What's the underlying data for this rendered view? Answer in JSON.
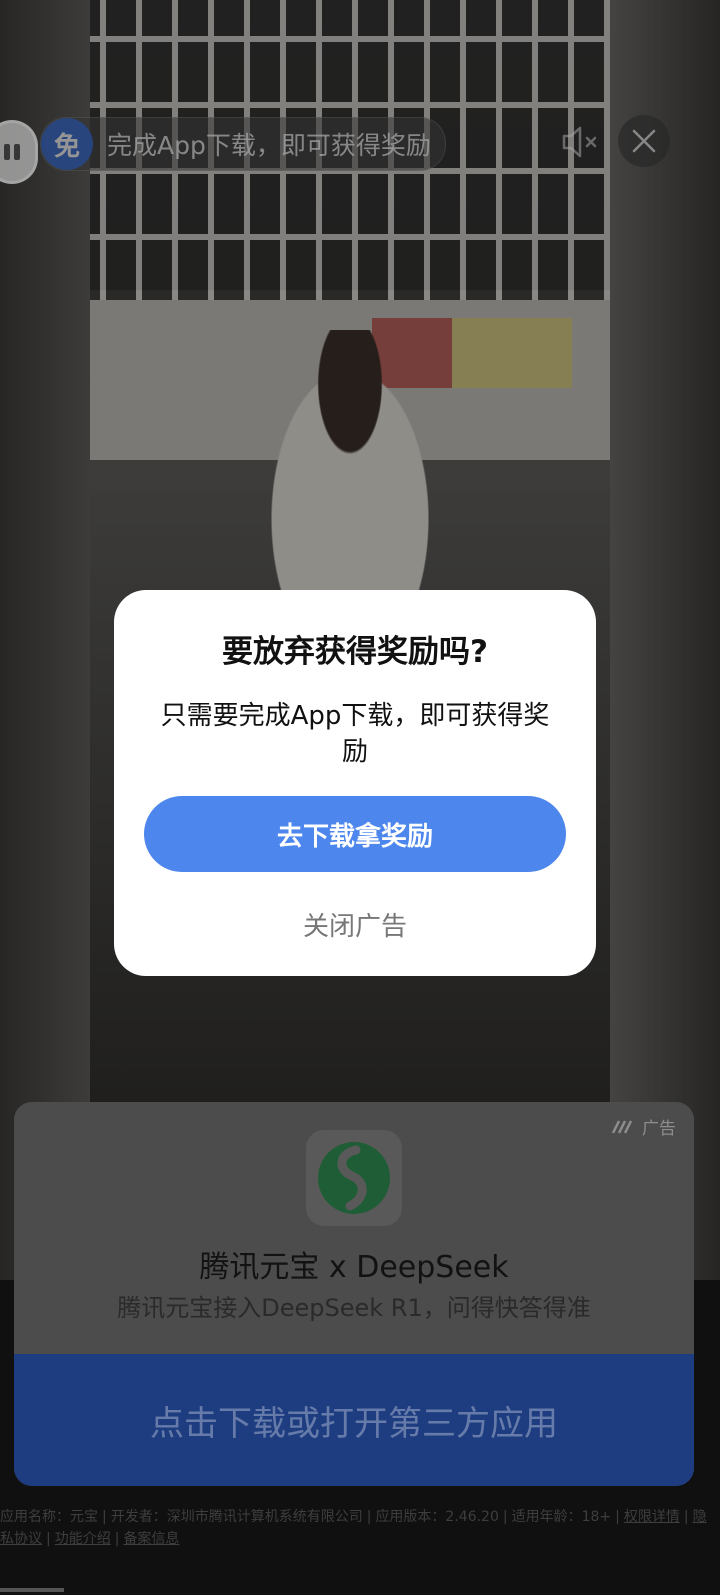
{
  "top_bar": {
    "reward_badge": "免",
    "reward_text": "完成App下载，即可获得奖励",
    "mute_icon": "speaker-muted-icon",
    "close_icon": "close-icon"
  },
  "dialog": {
    "title": "要放弃获得奖励吗?",
    "message": "只需要完成App下载，即可获得奖励",
    "primary_button": "去下载拿奖励",
    "secondary_button": "关闭广告"
  },
  "ad": {
    "label": "广告",
    "app_title": "腾讯元宝 x DeepSeek",
    "app_desc": "腾讯元宝接入DeepSeek R1，问得快答得准",
    "cta": "点击下载或打开第三方应用"
  },
  "footer": {
    "app_name": "应用名称：元宝",
    "developer": "开发者：深圳市腾讯计算机系统有限公司",
    "version": "应用版本：2.46.20",
    "age": "适用年龄：18+",
    "permissions": "权限详情",
    "privacy": "隐私协议",
    "features": "功能介绍",
    "filing": "备案信息"
  },
  "colors": {
    "primary": "#4d86ec",
    "badge": "#3d6fd4",
    "cta_bg": "#1e3d80"
  }
}
